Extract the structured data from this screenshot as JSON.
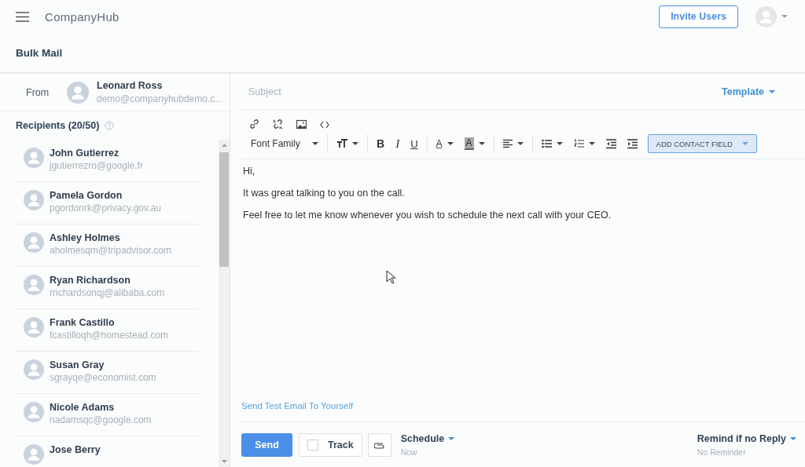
{
  "header": {
    "brand": "CompanyHub",
    "invite_button": "Invite Users"
  },
  "page_title": "Bulk Mail",
  "sender": {
    "label": "From",
    "name": "Leonard Ross",
    "email": "demo@companyhubdemo.c..."
  },
  "recipients": {
    "title": "Recipients (20/50)",
    "items": [
      {
        "name": "John Gutierrez",
        "email": "jgutierrezro@google.fr"
      },
      {
        "name": "Pamela Gordon",
        "email": "pgordonrk@privacy.gov.au"
      },
      {
        "name": "Ashley Holmes",
        "email": "aholmesqm@tripadvisor.com"
      },
      {
        "name": "Ryan Richardson",
        "email": "rrichardsonqj@alibaba.com"
      },
      {
        "name": "Frank Castillo",
        "email": "fcastilloqh@homestead.com"
      },
      {
        "name": "Susan Gray",
        "email": "sgrayqe@economist.com"
      },
      {
        "name": "Nicole Adams",
        "email": "nadamsqc@google.com"
      },
      {
        "name": "Jose Berry"
      }
    ]
  },
  "compose": {
    "subject_placeholder": "Subject",
    "template": "Template",
    "toolbar": {
      "font_family": "Font Family",
      "format_buttons": [
        {
          "label": "B",
          "kind": "bold"
        },
        {
          "label": "I",
          "kind": "italic"
        },
        {
          "label": "U",
          "kind": "underline"
        }
      ],
      "color_buttons": [
        {
          "label": "A",
          "kind": "text"
        },
        {
          "label": "A",
          "kind": "highlight"
        }
      ],
      "contact_field": "ADD CONTACT FIELD"
    },
    "body": [
      "Hi,",
      "It was great talking to you on the call.",
      "Feel free to let me know whenever you wish to schedule the next call with your CEO."
    ],
    "test_link": "Send Test Email To Yourself",
    "send": "Send",
    "track": {
      "label": "Track",
      "checked": false
    },
    "schedule": {
      "label": "Schedule",
      "value": "Now"
    },
    "remind": {
      "label": "Remind if no Reply",
      "value": "No Reminder"
    }
  }
}
